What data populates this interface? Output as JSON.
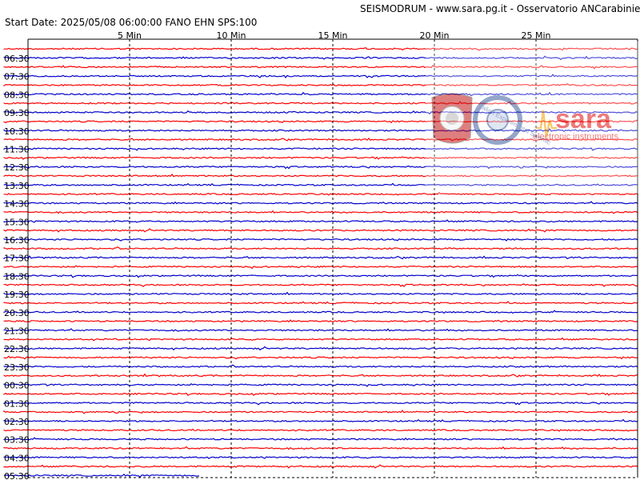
{
  "header": {
    "title": "SEISMODRUM - www.sara.pg.it - Osservatorio ANCarabinieri",
    "start_line": "Start Date: 2025/05/08 06:00:00 FANO   EHN  SPS:100"
  },
  "watermark": {
    "brand": "sara",
    "tagline": "electronic instruments",
    "seal_text": "Italian Experimental Seismic"
  },
  "colors": {
    "trace_red": "#ff0000",
    "trace_blue": "#0000cc",
    "grid": "#000000"
  },
  "chart_data": {
    "type": "line",
    "title": "",
    "xlabel": "",
    "ylabel": "",
    "x_unit": "minutes",
    "xlim": [
      0,
      30
    ],
    "x_ticks": [
      {
        "value": 5,
        "label": "5 Min"
      },
      {
        "value": 10,
        "label": "10 Min"
      },
      {
        "value": 15,
        "label": "15 Min"
      },
      {
        "value": 20,
        "label": "20 Min"
      },
      {
        "value": 25,
        "label": "25 Min"
      }
    ],
    "row_minutes": 30,
    "row_labels": [
      "06:30",
      "07:30",
      "08:30",
      "09:30",
      "10:30",
      "11:30",
      "12:30",
      "13:30",
      "14:30",
      "15:30",
      "16:30",
      "17:30",
      "18:30",
      "19:30",
      "20:30",
      "21:30",
      "22:30",
      "23:30",
      "00:30",
      "01:30",
      "02:30",
      "03:30",
      "04:30",
      "05:30"
    ],
    "trace_colors_alternate": [
      "red",
      "blue"
    ],
    "last_trace_end_minute": 8.5,
    "grid": true
  }
}
